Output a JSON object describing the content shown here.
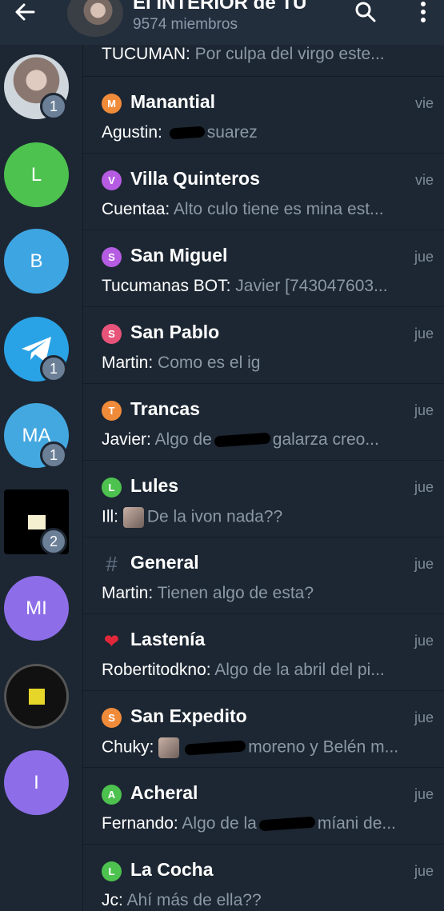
{
  "header": {
    "back_icon": "arrow-left-icon",
    "title": "El INTERIOR de TU",
    "members": "9574 miembros",
    "search_icon": "search-icon",
    "menu_icon": "more-vert-icon"
  },
  "rail": [
    {
      "initials": "",
      "badge": "1",
      "color": "#8a7770",
      "kind": "photo"
    },
    {
      "initials": "L",
      "badge": "",
      "color": "#4dc24f"
    },
    {
      "initials": "B",
      "badge": "",
      "color": "#3ea5e3"
    },
    {
      "initials": "",
      "badge": "1",
      "color": "#2aa3e6",
      "kind": "telegram"
    },
    {
      "initials": "MA",
      "badge": "1",
      "color": "#44a8e0"
    },
    {
      "initials": "",
      "badge": "2",
      "color": "#000000",
      "kind": "redacted"
    },
    {
      "initials": "MI",
      "badge": "",
      "color": "#8d6ee8"
    },
    {
      "initials": "",
      "badge": "",
      "color": "#111111",
      "kind": "redacted2"
    },
    {
      "initials": "I",
      "badge": "",
      "color": "#8d6ee8"
    }
  ],
  "first_preview": {
    "sender": "TUCUMAN:",
    "text": "Por culpa del virgo este..."
  },
  "topics": [
    {
      "letter": "M",
      "color": "#f08b3a",
      "name": "Manantial",
      "time": "vie",
      "sender": "Agustin:",
      "text": "suarez",
      "redacted": true
    },
    {
      "letter": "V",
      "color": "#b55ce3",
      "name": "Villa Quinteros",
      "time": "vie",
      "sender": "Cuentaa:",
      "text": "Alto culo tiene es mina est..."
    },
    {
      "letter": "S",
      "color": "#b55ce3",
      "name": "San Miguel",
      "time": "jue",
      "sender": "Tucumanas BOT:",
      "text": "Javier [743047603..."
    },
    {
      "letter": "S",
      "color": "#e8537a",
      "name": "San Pablo",
      "time": "jue",
      "sender": "Martin:",
      "text": "Como es el ig"
    },
    {
      "letter": "T",
      "color": "#f08b3a",
      "name": "Trancas",
      "time": "jue",
      "sender": "Javier:",
      "text": "Algo de",
      "text2": "galarza creo...",
      "redacted": true
    },
    {
      "letter": "L",
      "color": "#4dc24f",
      "name": "Lules",
      "time": "jue",
      "sender": "Ill:",
      "text": "De la ivon nada??",
      "thumb": true
    },
    {
      "letter": "#",
      "color": "transparent",
      "name": "General",
      "time": "jue",
      "sender": "Martin:",
      "text": "Tienen algo de esta?"
    },
    {
      "letter": "❤",
      "color": "transparent",
      "name": "Lastenía",
      "time": "jue",
      "sender": "Robertitodkno:",
      "text": "Algo de la abril del pi..."
    },
    {
      "letter": "S",
      "color": "#f08b3a",
      "name": "San Expedito",
      "time": "jue",
      "sender": "Chuky:",
      "text": "moreno y Belén m...",
      "thumb": true,
      "redacted_before": true
    },
    {
      "letter": "A",
      "color": "#4dc24f",
      "name": "Acheral",
      "time": "jue",
      "sender": "Fernando:",
      "text": "Algo de la",
      "text2": "míani de...",
      "redacted": true
    },
    {
      "letter": "L",
      "color": "#4dc24f",
      "name": "La Cocha",
      "time": "jue",
      "sender": "Jc:",
      "text": "Ahí más de ella??"
    }
  ]
}
